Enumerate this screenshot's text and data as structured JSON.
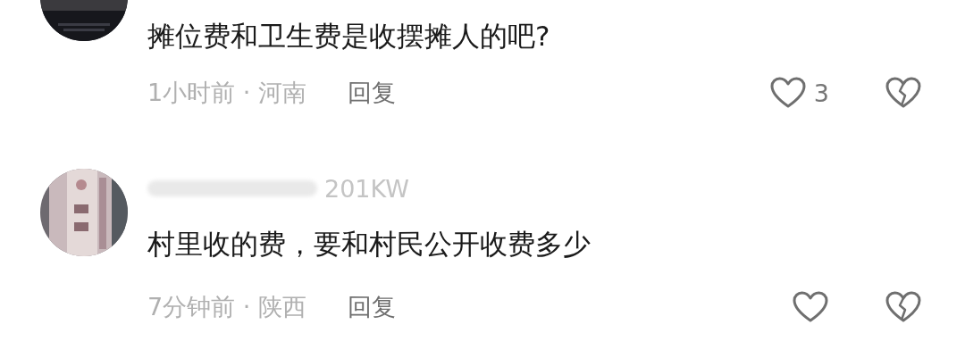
{
  "comments": [
    {
      "text": "摊位费和卫生费是收摆摊人的吧?",
      "meta": "1小时前 · 河南",
      "reply": "回复",
      "liked": false,
      "like_count": "3",
      "disliked": false
    },
    {
      "username": "201KW",
      "username_redacted": true,
      "text": "村里收的费，要和村民公开收费多少",
      "meta": "7分钟前 · 陕西",
      "reply": "回复",
      "liked": false,
      "disliked": false
    }
  ]
}
